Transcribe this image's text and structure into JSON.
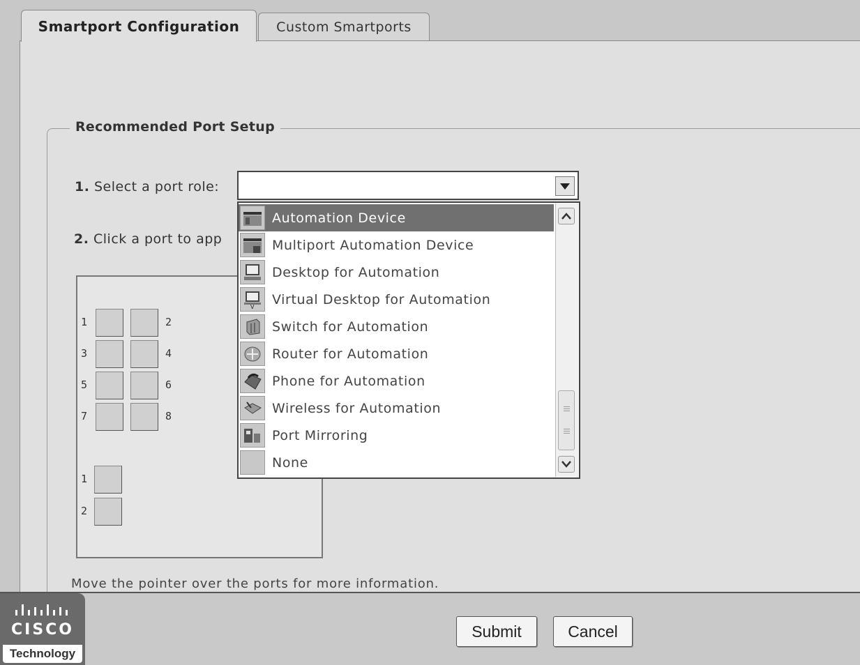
{
  "tabs": [
    {
      "label": "Smartport Configuration",
      "active": true
    },
    {
      "label": "Custom Smartports",
      "active": false
    }
  ],
  "section": {
    "legend": "Recommended Port Setup"
  },
  "step1": {
    "num": "1.",
    "text": "Select a port role:"
  },
  "step2": {
    "num": "2.",
    "text": "Click a port to app"
  },
  "select": {
    "value": ""
  },
  "dropdown": {
    "options": [
      {
        "label": "Automation Device",
        "icon": "automation-device-icon",
        "selected": true
      },
      {
        "label": "Multiport Automation Device",
        "icon": "multiport-automation-device-icon"
      },
      {
        "label": "Desktop for Automation",
        "icon": "desktop-icon"
      },
      {
        "label": "Virtual Desktop for Automation",
        "icon": "virtual-desktop-icon"
      },
      {
        "label": "Switch for Automation",
        "icon": "switch-icon"
      },
      {
        "label": "Router for Automation",
        "icon": "router-icon"
      },
      {
        "label": "Phone for Automation",
        "icon": "phone-icon"
      },
      {
        "label": "Wireless for Automation",
        "icon": "wireless-icon"
      },
      {
        "label": "Port Mirroring",
        "icon": "port-mirroring-icon"
      },
      {
        "label": "None",
        "icon": "none-icon"
      }
    ]
  },
  "ports": {
    "grid": [
      "1",
      "2",
      "3",
      "4",
      "5",
      "6",
      "7",
      "8"
    ],
    "uplinks": [
      "1",
      "2"
    ]
  },
  "hint": "Move the pointer over the ports for more information.",
  "footer": {
    "logo_word": "CISCO",
    "logo_tagline": "Technology",
    "submit_label": "Submit",
    "cancel_label": "Cancel"
  }
}
